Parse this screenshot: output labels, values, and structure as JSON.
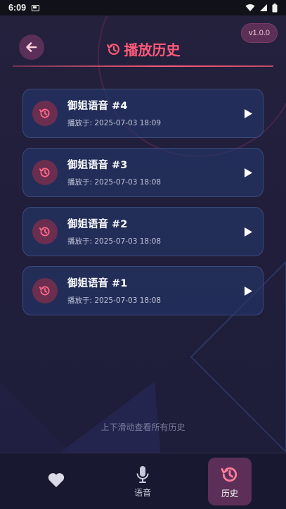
{
  "status_bar": {
    "time": "6:09"
  },
  "header": {
    "back_icon": "arrow-left-icon",
    "title": "播放历史",
    "title_icon": "history-icon",
    "version": "v1.0.0"
  },
  "history": [
    {
      "name": "御姐语音 #4",
      "time": "播放于: 2025-07-03 18:09"
    },
    {
      "name": "御姐语音 #3",
      "time": "播放于: 2025-07-03 18:08"
    },
    {
      "name": "御姐语音 #2",
      "time": "播放于: 2025-07-03 18:08"
    },
    {
      "name": "御姐语音 #1",
      "time": "播放于: 2025-07-03 18:08"
    }
  ],
  "hint": "上下滑动查看所有历史",
  "bottom_nav": [
    {
      "label": "",
      "icon": "heart-icon"
    },
    {
      "label": "语音",
      "icon": "microphone-icon"
    },
    {
      "label": "历史",
      "icon": "history-icon",
      "active": true
    }
  ],
  "colors": {
    "accent": "#ff5a7a",
    "background": "#1e1d38",
    "card": "#243668"
  }
}
